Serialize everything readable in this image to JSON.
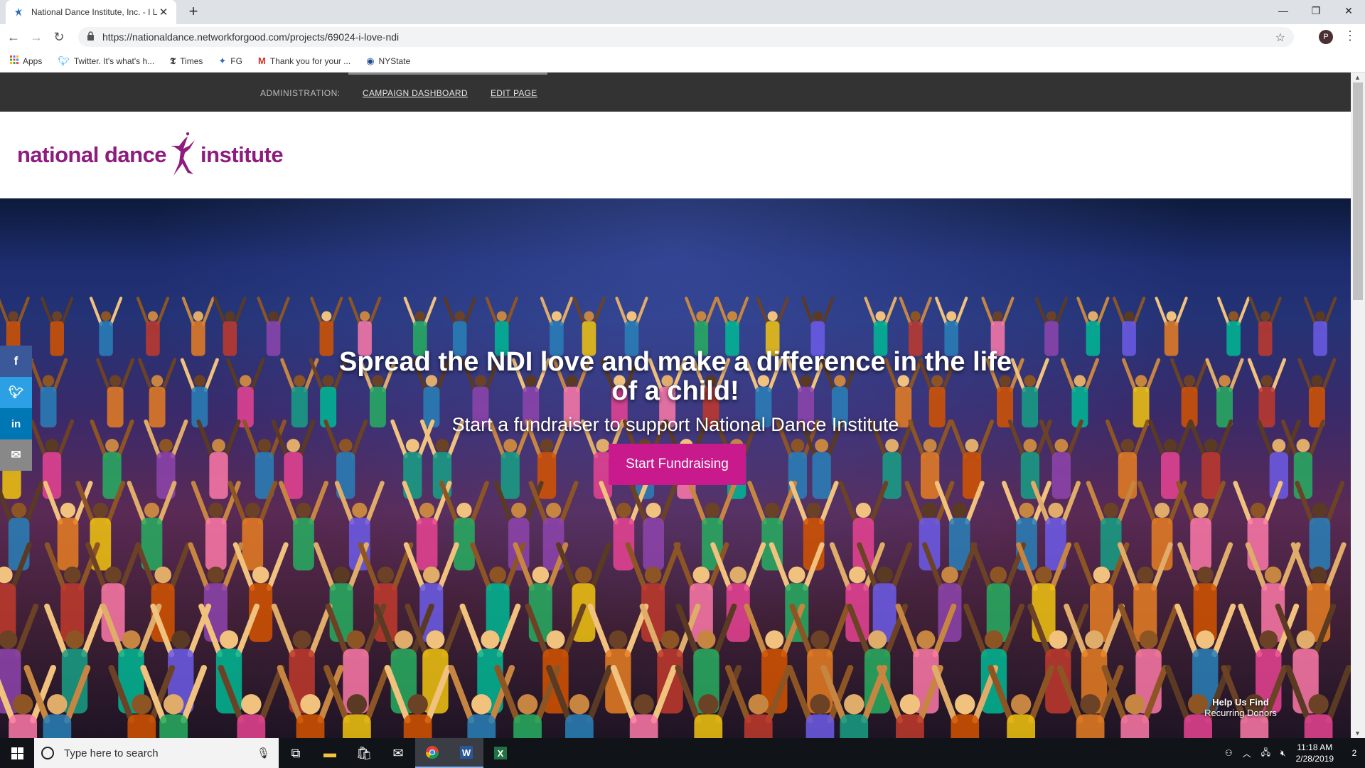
{
  "browser": {
    "tab_title": "National Dance Institute, Inc. - I L",
    "url": "https://nationaldance.networkforgood.com/projects/69024-i-love-ndi",
    "profile_initial": "P",
    "bookmarks": [
      {
        "label": "Apps",
        "icon": "apps-grid-icon"
      },
      {
        "label": "Twitter. It's what's h...",
        "icon": "twitter-icon"
      },
      {
        "label": "Times",
        "icon": "nyt-icon"
      },
      {
        "label": "FG",
        "icon": "dancer-icon"
      },
      {
        "label": "Thank you for your ...",
        "icon": "gmail-icon"
      },
      {
        "label": "NYState",
        "icon": "nystate-icon"
      }
    ]
  },
  "admin": {
    "label": "ADMINISTRATION:",
    "dashboard_link": "CAMPAIGN DASHBOARD",
    "edit_link": "EDIT PAGE"
  },
  "logo": {
    "left_text": "national dance",
    "right_text": "institute",
    "color": "#8e1b7d"
  },
  "hero": {
    "title": "Spread the NDI love and make a difference in the life of a child!",
    "subtitle": "Start a fundraiser to support National Dance Institute",
    "button": "Start Fundraising",
    "button_color": "#c8198d",
    "help_line1": "Help Us Find",
    "help_line2": "Recurring Donors"
  },
  "social": [
    {
      "icon": "facebook-icon",
      "glyph": "f",
      "color": "#3b5998"
    },
    {
      "icon": "twitter-icon",
      "glyph": "t",
      "color": "#2ba0e4"
    },
    {
      "icon": "linkedin-icon",
      "glyph": "in",
      "color": "#0077b5"
    },
    {
      "icon": "email-icon",
      "glyph": "✉",
      "color": "#888888"
    }
  ],
  "taskbar": {
    "search_placeholder": "Type here to search",
    "time": "11:18 AM",
    "date": "2/28/2019",
    "notification_count": "2"
  }
}
